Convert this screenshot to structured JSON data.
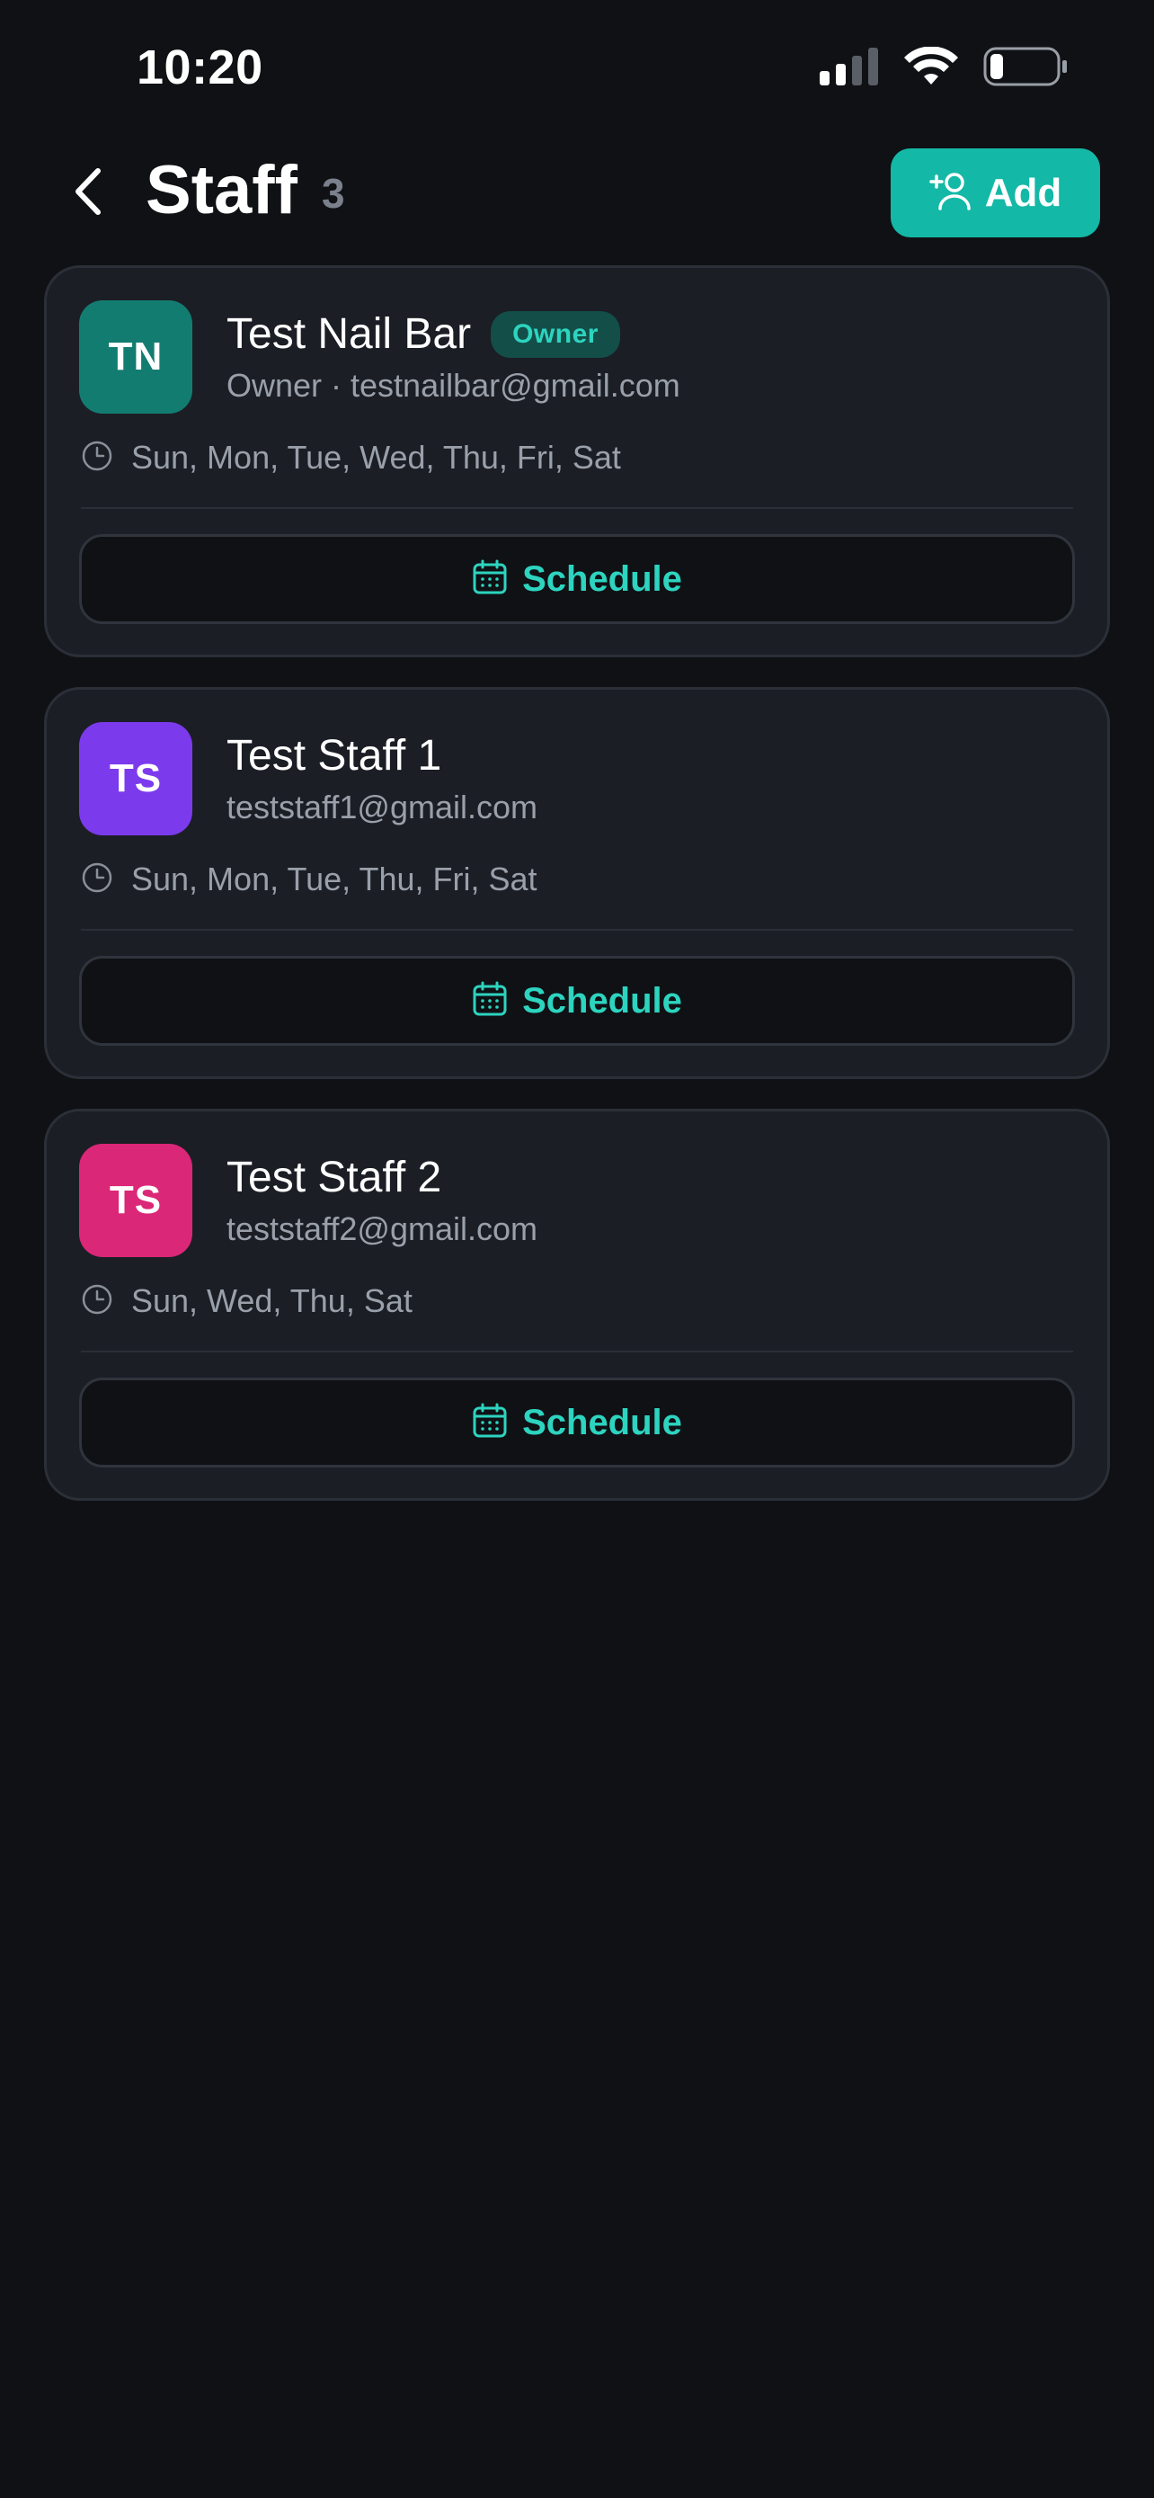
{
  "status_bar": {
    "time": "10:20",
    "icons": [
      "cellular-signal-icon",
      "wifi-icon",
      "battery-icon"
    ]
  },
  "header": {
    "back_icon": "chevron-left-icon",
    "title": "Staff",
    "count": "3",
    "add_button": {
      "label": "Add",
      "icon": "add-user-icon"
    }
  },
  "colors": {
    "background": "#0f1115",
    "card": "#1b1e25",
    "accent": "#14b8a6",
    "accent_text": "#2dd4bf"
  },
  "staff": [
    {
      "initials": "TN",
      "avatar_color": "#137c71",
      "name": "Test Nail Bar",
      "badge": "Owner",
      "subline": "Owner · testnailbar@gmail.com",
      "days": "Sun, Mon, Tue, Wed, Thu, Fri, Sat",
      "schedule_label": "Schedule"
    },
    {
      "initials": "TS",
      "avatar_color": "#7c3aed",
      "name": "Test Staff 1",
      "badge": "",
      "subline": "teststaff1@gmail.com",
      "days": "Sun, Mon, Tue, Thu, Fri, Sat",
      "schedule_label": "Schedule"
    },
    {
      "initials": "TS",
      "avatar_color": "#db2777",
      "name": "Test Staff 2",
      "badge": "",
      "subline": "teststaff2@gmail.com",
      "days": "Sun, Wed, Thu, Sat",
      "schedule_label": "Schedule"
    }
  ]
}
